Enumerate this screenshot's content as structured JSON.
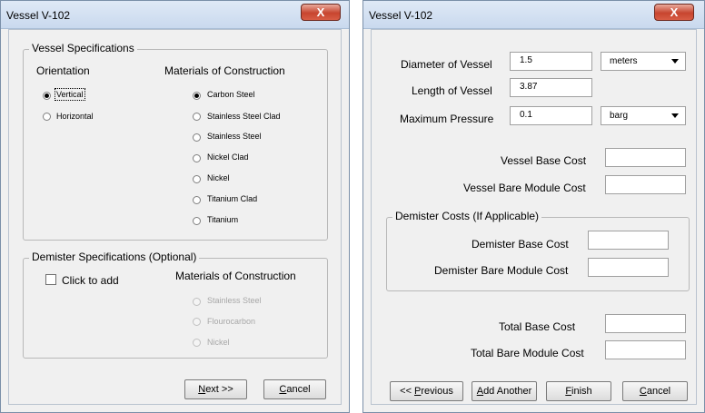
{
  "left": {
    "title": "Vessel V-102",
    "close": "X",
    "vessel_group": "Vessel Specifications",
    "orientation_label": "Orientation",
    "materials_label": "Materials of Construction",
    "orientation": [
      "Vertical",
      "Horizontal"
    ],
    "materials": [
      "Carbon Steel",
      "Stainless Steel Clad",
      "Stainless Steel",
      "Nickel Clad",
      "Nickel",
      "Titanium Clad",
      "Titanium"
    ],
    "demister_group": "Demister Specifications (Optional)",
    "click_to_add": "Click to add",
    "demister_materials_label": "Materials of Construction",
    "demister_materials": [
      "Stainless Steel",
      "Flourocarbon",
      "Nickel"
    ],
    "next_prefix": "N",
    "next_rest": "ext >>",
    "cancel_prefix": "C",
    "cancel_rest": "ancel"
  },
  "right": {
    "title": "Vessel V-102",
    "close": "X",
    "diameter_label": "Diameter of Vessel",
    "diameter_value": "1.5",
    "diameter_unit": "meters",
    "length_label": "Length of Vessel",
    "length_value": "3.87",
    "pressure_label": "Maximum Pressure",
    "pressure_value": "0.1",
    "pressure_unit": "barg",
    "vessel_base_cost_label": "Vessel Base Cost",
    "vessel_bare_module_cost_label": "Vessel Bare Module Cost",
    "demister_group": "Demister Costs (If Applicable)",
    "demister_base_cost_label": "Demister Base Cost",
    "demister_bare_module_cost_label": "Demister Bare Module Cost",
    "total_base_cost_label": "Total Base Cost",
    "total_bare_module_cost_label": "Total Bare Module Cost",
    "previous_a": "<< ",
    "previous_u": "P",
    "previous_b": "revious",
    "add_another_u": "A",
    "add_another_b": "dd Another",
    "finish_u": "F",
    "finish_b": "inish",
    "cancel_u": "C",
    "cancel_b": "ancel"
  }
}
